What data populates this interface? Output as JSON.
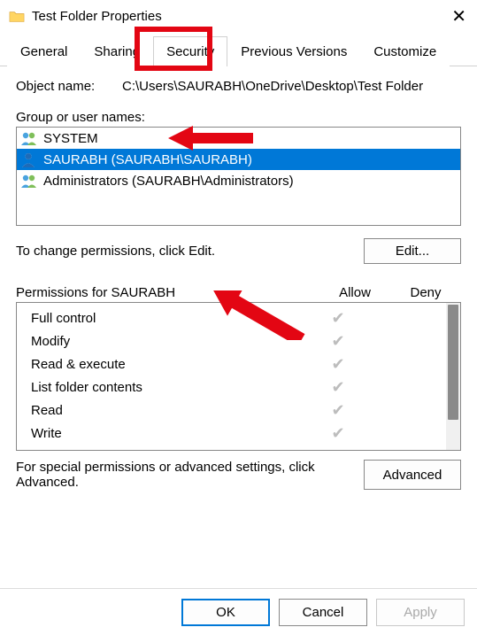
{
  "title": "Test Folder Properties",
  "tabs": [
    "General",
    "Sharing",
    "Security",
    "Previous Versions",
    "Customize"
  ],
  "active_tab_index": 2,
  "object_name_label": "Object name:",
  "object_name": "C:\\Users\\SAURABH\\OneDrive\\Desktop\\Test Folder",
  "group_label": "Group or user names:",
  "principals": [
    {
      "type": "group",
      "display": "SYSTEM",
      "selected": false
    },
    {
      "type": "user",
      "display": "SAURABH (SAURABH\\SAURABH)",
      "selected": true
    },
    {
      "type": "group",
      "display": "Administrators (SAURABH\\Administrators)",
      "selected": false
    }
  ],
  "edit_hint": "To change permissions, click Edit.",
  "edit_btn": "Edit...",
  "perm_header": "Permissions for SAURABH",
  "allow_label": "Allow",
  "deny_label": "Deny",
  "permissions": [
    {
      "name": "Full control",
      "allow": true,
      "deny": false
    },
    {
      "name": "Modify",
      "allow": true,
      "deny": false
    },
    {
      "name": "Read & execute",
      "allow": true,
      "deny": false
    },
    {
      "name": "List folder contents",
      "allow": true,
      "deny": false
    },
    {
      "name": "Read",
      "allow": true,
      "deny": false
    },
    {
      "name": "Write",
      "allow": true,
      "deny": false
    }
  ],
  "advanced_hint": "For special permissions or advanced settings, click Advanced.",
  "advanced_btn": "Advanced",
  "ok_btn": "OK",
  "cancel_btn": "Cancel",
  "apply_btn": "Apply",
  "annotation_color": "#e30613"
}
